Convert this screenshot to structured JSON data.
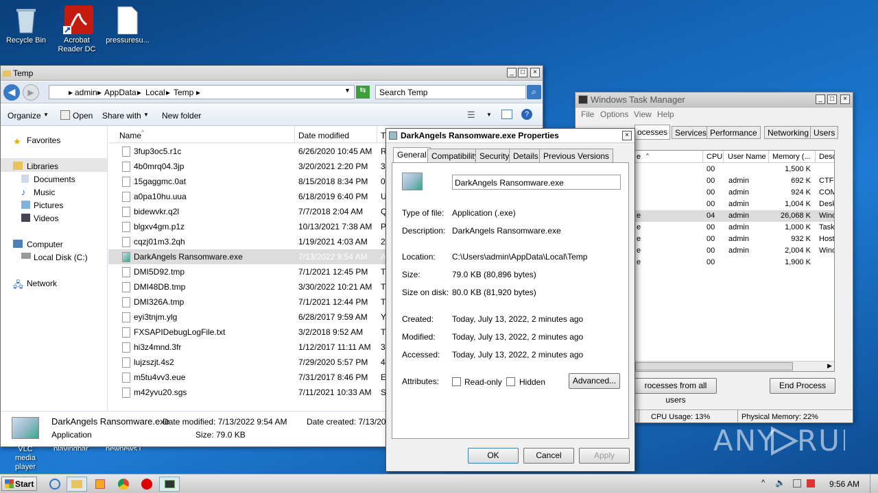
{
  "desktop": {
    "icons": [
      {
        "label": "Recycle Bin"
      },
      {
        "label": "Acrobat Reader DC"
      },
      {
        "label": "pressuresu..."
      }
    ],
    "hidden_icons": [
      "VLC media player",
      "playingbar...",
      "newnews.j..."
    ]
  },
  "explorer": {
    "title": "Temp",
    "breadcrumb": [
      "admin",
      "AppData",
      "Local",
      "Temp"
    ],
    "search_placeholder": "Search Temp",
    "toolbar": {
      "organize": "Organize",
      "open": "Open",
      "share_with": "Share with",
      "new_folder": "New folder"
    },
    "nav": {
      "favorites": "Favorites",
      "libraries": "Libraries",
      "documents": "Documents",
      "music": "Music",
      "pictures": "Pictures",
      "videos": "Videos",
      "computer": "Computer",
      "local_disk": "Local Disk (C:)",
      "network": "Network"
    },
    "columns": {
      "name": "Name",
      "date_modified": "Date modified",
      "type": "T"
    },
    "files": [
      {
        "name": "3fup3oc5.r1c",
        "date": "6/26/2020 10:45 AM",
        "type": "R"
      },
      {
        "name": "4b0mrq04.3jp",
        "date": "3/20/2021 2:20 PM",
        "type": "3"
      },
      {
        "name": "15gaggmc.0at",
        "date": "8/15/2018 8:34 PM",
        "type": "0"
      },
      {
        "name": "a0pa10hu.uua",
        "date": "6/18/2019 6:40 PM",
        "type": "U"
      },
      {
        "name": "bidewvkr.q2l",
        "date": "7/7/2018 2:04 AM",
        "type": "Q"
      },
      {
        "name": "blgxv4gm.p1z",
        "date": "10/13/2021 7:38 AM",
        "type": "P"
      },
      {
        "name": "cqzj01m3.2qh",
        "date": "1/19/2021 4:03 AM",
        "type": "2"
      },
      {
        "name": "DarkAngels Ransomware.exe",
        "date": "7/13/2022 9:54 AM",
        "type": "A"
      },
      {
        "name": "DMI5D92.tmp",
        "date": "7/1/2021 12:45 PM",
        "type": "T"
      },
      {
        "name": "DMI48DB.tmp",
        "date": "3/30/2022 10:21 AM",
        "type": "T"
      },
      {
        "name": "DMI326A.tmp",
        "date": "7/1/2021 12:44 PM",
        "type": "T"
      },
      {
        "name": "eyi3tnjm.ylg",
        "date": "6/28/2017 9:59 AM",
        "type": "Y"
      },
      {
        "name": "FXSAPIDebugLogFile.txt",
        "date": "3/2/2018 9:52 AM",
        "type": "T"
      },
      {
        "name": "hi3z4mnd.3fr",
        "date": "1/12/2017 11:11 AM",
        "type": "3"
      },
      {
        "name": "lujzszjt.4s2",
        "date": "7/29/2020 5:57 PM",
        "type": "4"
      },
      {
        "name": "m5tu4vv3.eue",
        "date": "7/31/2017 8:46 PM",
        "type": "E"
      },
      {
        "name": "m42yvu20.sgs",
        "date": "7/11/2021 10:33 AM",
        "type": "S"
      }
    ],
    "details": {
      "name": "DarkAngels Ransomware.exe",
      "date_modified": "Date modified: 7/13/2022 9:54 AM",
      "date_created": "Date created: 7/13/202",
      "type": "Application",
      "size": "Size: 79.0 KB"
    }
  },
  "properties": {
    "title": "DarkAngels Ransomware.exe Properties",
    "tabs": [
      "General",
      "Compatibility",
      "Security",
      "Details",
      "Previous Versions"
    ],
    "filename": "DarkAngels Ransomware.exe",
    "type_label": "Type of file:",
    "type_value": "Application (.exe)",
    "desc_label": "Description:",
    "desc_value": "DarkAngels Ransomware.exe",
    "location_label": "Location:",
    "location_value": "C:\\Users\\admin\\AppData\\Local\\Temp",
    "size_label": "Size:",
    "size_value": "79.0 KB (80,896 bytes)",
    "sod_label": "Size on disk:",
    "sod_value": "80.0 KB (81,920 bytes)",
    "created_label": "Created:",
    "created_value": "Today, July 13, 2022, 2 minutes ago",
    "modified_label": "Modified:",
    "modified_value": "Today, July 13, 2022, 2 minutes ago",
    "accessed_label": "Accessed:",
    "accessed_value": "Today, July 13, 2022, 2 minutes ago",
    "attributes_label": "Attributes:",
    "readonly_label": "Read-only",
    "hidden_label": "Hidden",
    "advanced_label": "Advanced...",
    "ok_label": "OK",
    "cancel_label": "Cancel",
    "apply_label": "Apply"
  },
  "taskmanager": {
    "title": "Windows Task Manager",
    "menu": [
      "File",
      "Options",
      "View",
      "Help"
    ],
    "tabs": [
      "ocesses",
      "Services",
      "Performance",
      "Networking",
      "Users"
    ],
    "columns": [
      "e",
      "CPU",
      "User Name",
      "Memory (...",
      "Desc"
    ],
    "rows": [
      {
        "n": "",
        "cpu": "00",
        "user": "",
        "mem": "1,500 K",
        "desc": ""
      },
      {
        "n": "",
        "cpu": "00",
        "user": "admin",
        "mem": "692 K",
        "desc": "CTF l"
      },
      {
        "n": "",
        "cpu": "00",
        "user": "admin",
        "mem": "924 K",
        "desc": "COM"
      },
      {
        "n": "",
        "cpu": "00",
        "user": "admin",
        "mem": "1,004 K",
        "desc": "Desk"
      },
      {
        "n": "e",
        "cpu": "04",
        "user": "admin",
        "mem": "26,068 K",
        "desc": "Wind"
      },
      {
        "n": "e",
        "cpu": "00",
        "user": "admin",
        "mem": "1,000 K",
        "desc": "Task"
      },
      {
        "n": "e",
        "cpu": "00",
        "user": "admin",
        "mem": "932 K",
        "desc": "Host"
      },
      {
        "n": "e",
        "cpu": "00",
        "user": "admin",
        "mem": "2,004 K",
        "desc": "Wind"
      },
      {
        "n": "e",
        "cpu": "00",
        "user": "",
        "mem": "1,900 K",
        "desc": ""
      }
    ],
    "show_all_label": "rocesses from all users",
    "end_process_label": "End Process",
    "cpu_usage": "CPU Usage: 13%",
    "physical_memory": "Physical Memory: 22%"
  },
  "taskbar": {
    "start_label": "Start",
    "clock": "9:56 AM"
  },
  "watermark": "ANY RUN"
}
